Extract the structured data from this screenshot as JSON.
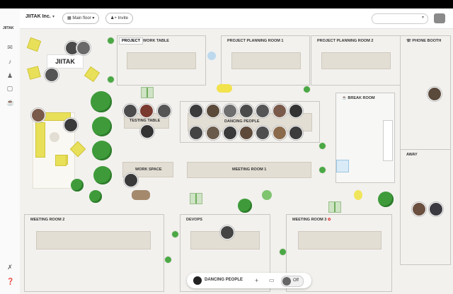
{
  "sidebar": {
    "logo": "JIITAK",
    "icons": [
      "megaphone-icon",
      "bell-icon",
      "users-icon",
      "chat-icon",
      "coffee-icon",
      "tools-icon",
      "help-icon"
    ]
  },
  "topbar": {
    "org": "JIITAK Inc.",
    "floor": "Main floor",
    "invite": "Invite"
  },
  "map": {
    "logo_text": "JIITAK",
    "rooms": {
      "project": "PROJECT",
      "work_table": "WORK TABLE",
      "planning1": "PROJECT PLANNING ROOM 1",
      "planning2": "PROJECT PLANNING ROOM 2",
      "phone_booth": "PHONE BOOTH",
      "break_room": "BREAK ROOM",
      "away": "AWAY",
      "testing_table": "TESTING TABLE",
      "dancing_people": "DANCING PEOPLE",
      "work_space": "WORK SPACE",
      "meeting1": "MEETING ROOM 1",
      "meeting2": "MEETING ROOM 2",
      "devops": "DEVOPS",
      "meeting3": "MEETING ROOM 3"
    }
  },
  "dock": {
    "room": "DANCING PEOPLE",
    "toggle_label": "Off",
    "add": "+"
  },
  "colors": {
    "table": "#e3ded4",
    "plant": "#3f9b3a",
    "sofa": "#e9e05a",
    "floor": "#f2f1ee"
  }
}
